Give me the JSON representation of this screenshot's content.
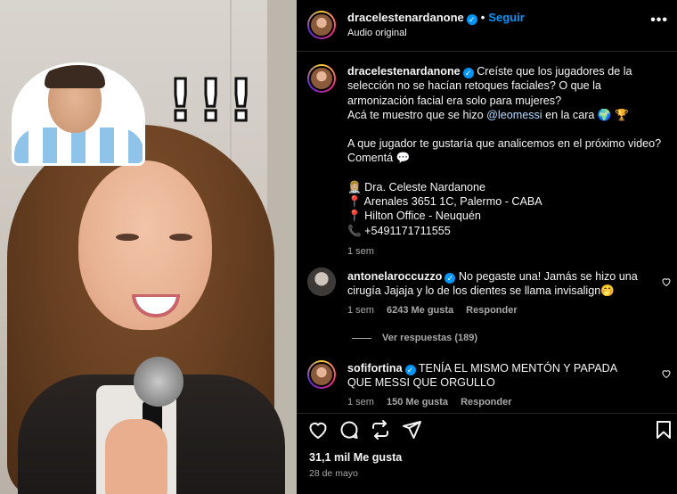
{
  "post": {
    "username": "dracelestenardanone",
    "follow_label": "Seguir",
    "audio": "Audio original",
    "more_label": "•••"
  },
  "media": {
    "exclamations": [
      "!",
      "!",
      "!"
    ]
  },
  "caption": {
    "username": "dracelestenardanone",
    "line1": "Creíste que los jugadores de la selección no se hacían retoques faciales? O que la armonización facial era solo para mujeres?",
    "line2_prefix": "Acá te muestro que se hizo",
    "mention": "@leomessi",
    "line2_suffix": "en la cara 🌍 🏆",
    "question": "A que jugador te gustaría que analicemos en el próximo video? Comentá 💬",
    "contact": [
      "👩🏼‍⚕️ Dra. Celeste Nardanone",
      "📍 Arenales 3651 1C, Palermo - CABA",
      "📍 Hilton Office - Neuquén",
      "📞 +5491171711555"
    ],
    "time": "1 sem"
  },
  "comments": [
    {
      "username": "antonelaroccuzzo",
      "text": "No pegaste una! Jamás se hizo una cirugía Jajaja y lo de los dientes se llama invisalign🤭",
      "time": "1 sem",
      "likes": "6243 Me gusta",
      "reply": "Responder",
      "view_replies": "Ver respuestas (189)"
    },
    {
      "username": "sofifortina",
      "text": "TENÍA EL MISMO MENTÓN Y PAPADA QUE MESSI QUE ORGULLO",
      "time": "1 sem",
      "likes": "150 Me gusta",
      "reply": "Responder"
    }
  ],
  "footer": {
    "likes": "31,1 mil Me gusta",
    "date": "28 de mayo"
  },
  "colors": {
    "background": "#000000",
    "accent": "#0095f6",
    "muted": "#a8a8a8"
  },
  "icons": [
    "heart-icon",
    "comment-icon",
    "repost-icon",
    "share-icon",
    "bookmark-icon",
    "verified-icon",
    "more-icon"
  ]
}
